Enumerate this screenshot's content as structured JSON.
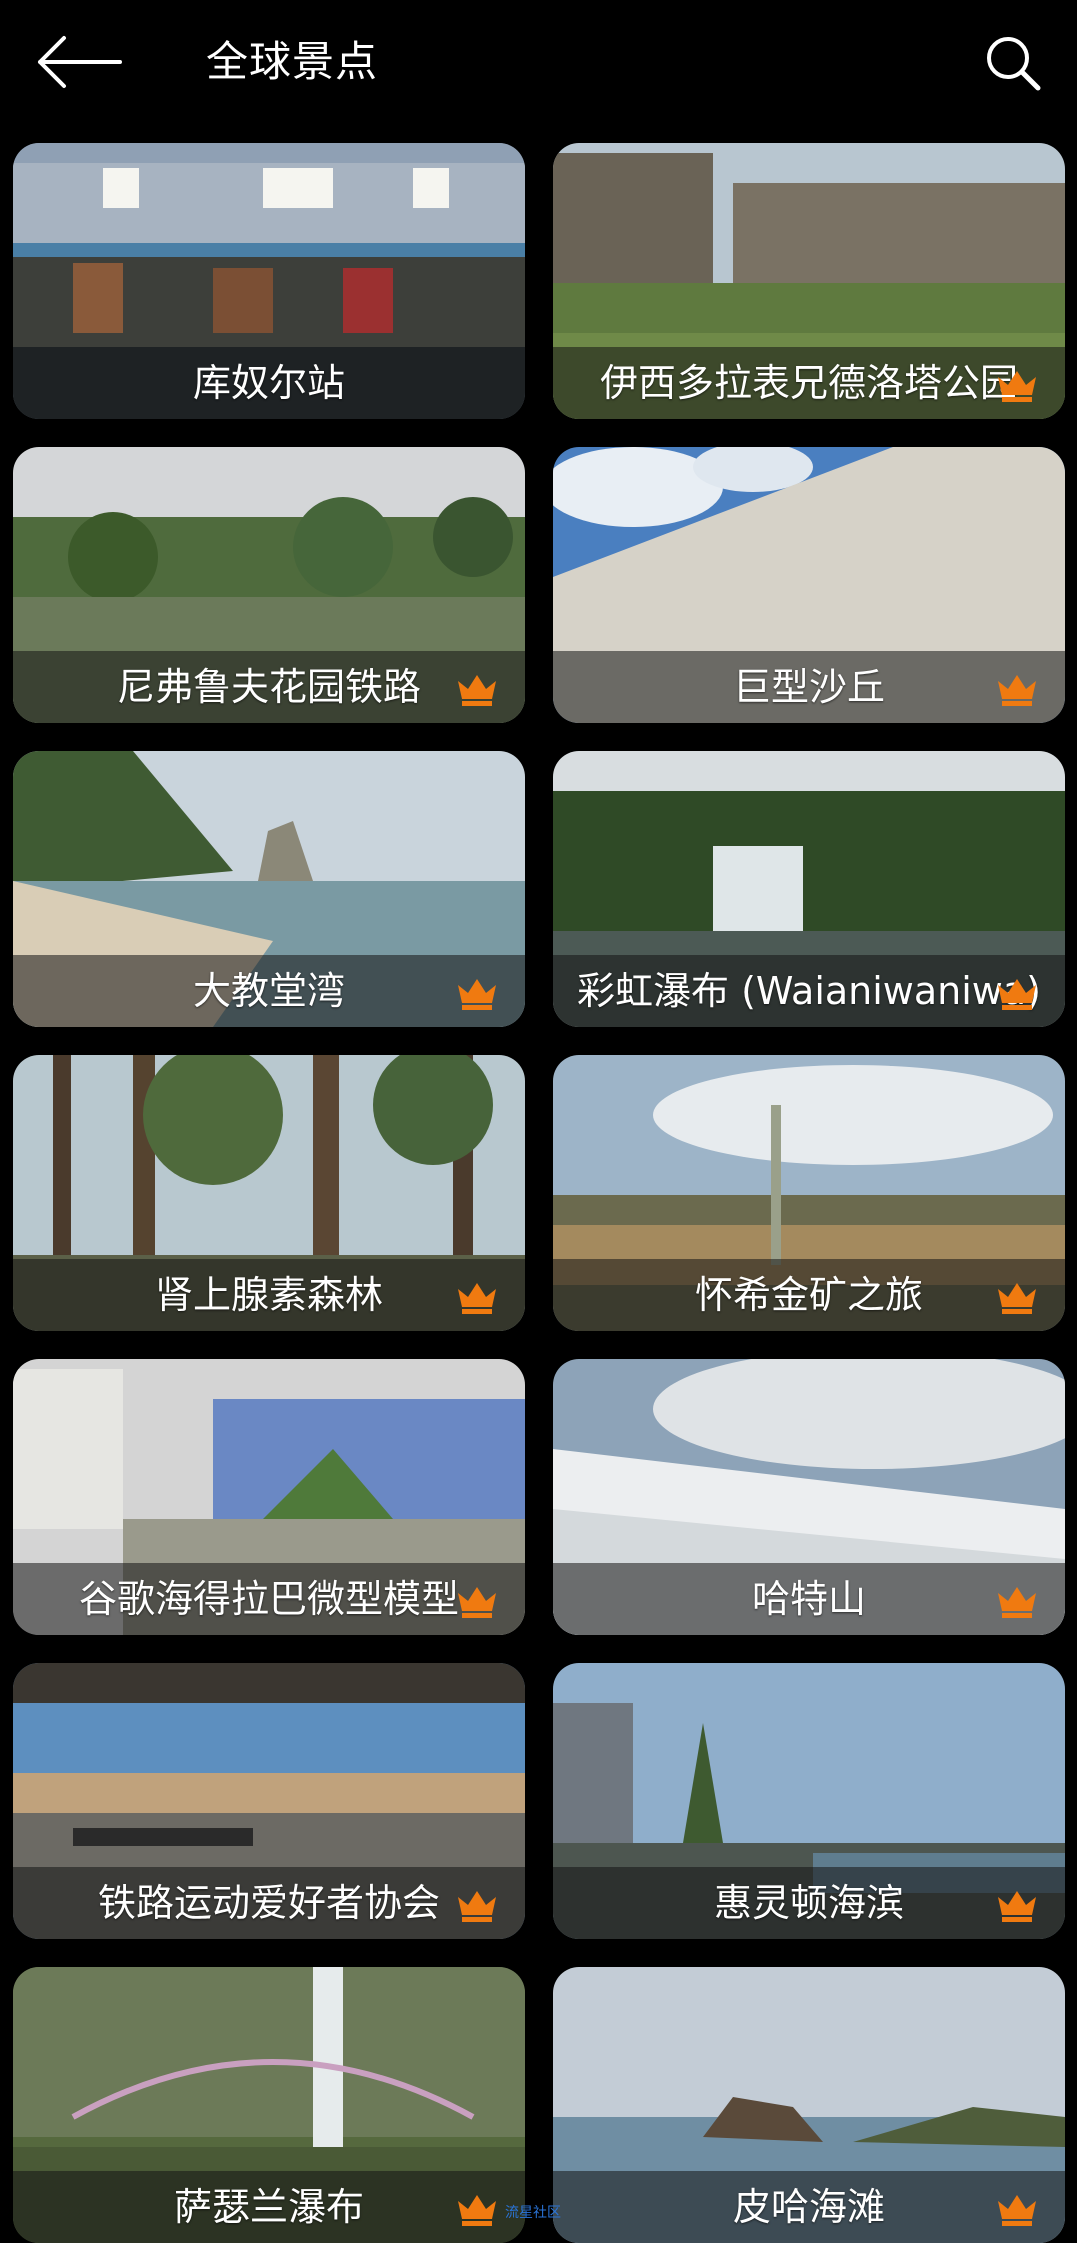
{
  "header": {
    "title": "全球景点",
    "back_icon": "arrow-left-icon",
    "search_icon": "search-icon"
  },
  "colors": {
    "crown": "#f07a10",
    "background": "#000000"
  },
  "spots": [
    {
      "name": "库奴尔站",
      "premium": false
    },
    {
      "name": "伊西多拉表兄德洛塔公园",
      "premium": true
    },
    {
      "name": "尼弗鲁夫花园铁路",
      "premium": true
    },
    {
      "name": "巨型沙丘",
      "premium": true
    },
    {
      "name": "大教堂湾",
      "premium": true
    },
    {
      "name": "彩虹瀑布 (Waianiwaniwa)",
      "premium": true
    },
    {
      "name": "肾上腺素森林",
      "premium": true
    },
    {
      "name": "怀希金矿之旅",
      "premium": true
    },
    {
      "name": "谷歌海得拉巴微型模型",
      "premium": true
    },
    {
      "name": "哈特山",
      "premium": true
    },
    {
      "name": "铁路运动爱好者协会",
      "premium": true
    },
    {
      "name": "惠灵顿海滨",
      "premium": true
    },
    {
      "name": "萨瑟兰瀑布",
      "premium": true
    },
    {
      "name": "皮哈海滩",
      "premium": true
    }
  ],
  "watermark": "流星社区"
}
